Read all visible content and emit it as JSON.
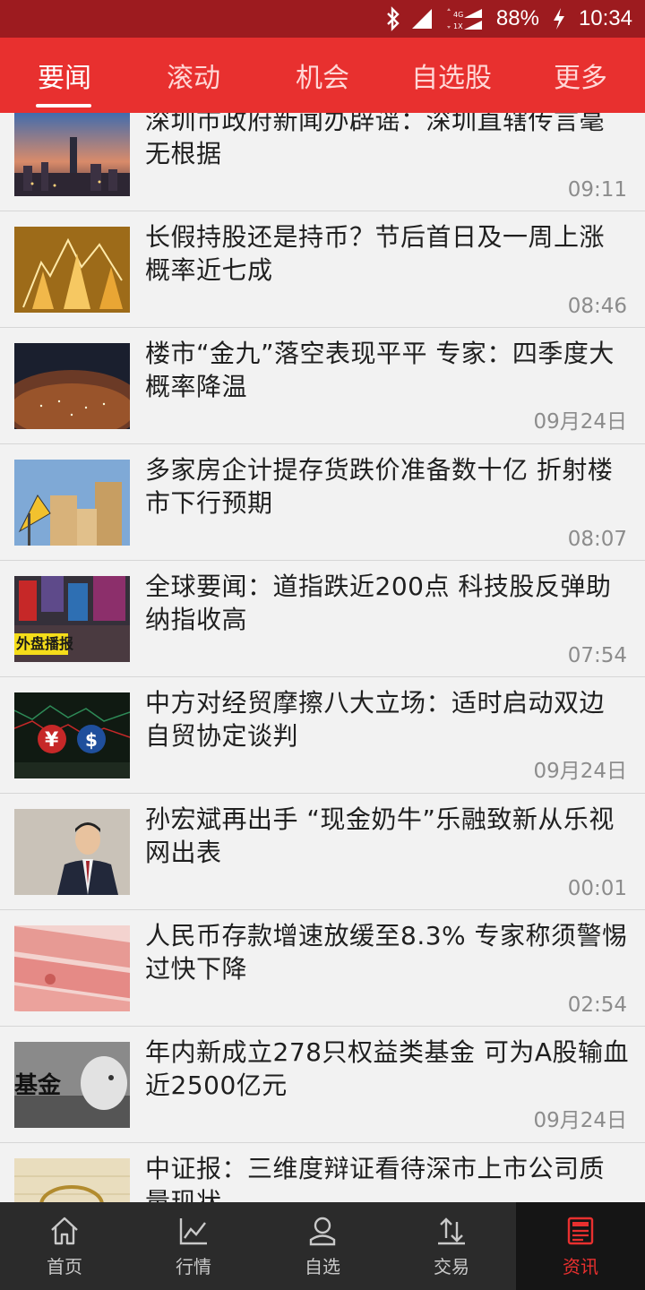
{
  "status_bar": {
    "battery": "88%",
    "time": "10:34",
    "network": "4G",
    "network2": "1X"
  },
  "tabs": [
    {
      "label": "要闻",
      "active": true
    },
    {
      "label": "滚动",
      "active": false
    },
    {
      "label": "机会",
      "active": false
    },
    {
      "label": "自选股",
      "active": false
    },
    {
      "label": "更多",
      "active": false
    }
  ],
  "news": [
    {
      "title": "深圳市政府新闻办辟谣：深圳直辖传言毫无根据",
      "time": "09:11",
      "thumb": "city-skyline"
    },
    {
      "title": "长假持股还是持币？节后首日及一周上涨概率近七成",
      "time": "08:46",
      "thumb": "rising-arrows"
    },
    {
      "title": "楼市“金九”落空表现平平 专家：四季度大概率降温",
      "time": "09月24日",
      "thumb": "city-night"
    },
    {
      "title": "多家房企计提存货跌价准备数十亿 折射楼市下行预期",
      "time": "08:07",
      "thumb": "buildings-down-sign"
    },
    {
      "title": "全球要闻：道指跌近200点 科技股反弹助纳指收高",
      "time": "07:54",
      "thumb": "times-square",
      "badge": "外盘播报"
    },
    {
      "title": "中方对经贸摩擦八大立场：适时启动双边自贸协定谈判",
      "time": "09月24日",
      "thumb": "yuan-dollar"
    },
    {
      "title": "孙宏斌再出手 “现金奶牛”乐融致新从乐视网出表",
      "time": "00:01",
      "thumb": "businessman"
    },
    {
      "title": "人民币存款增速放缓至8.3% 专家称须警惕过快下降",
      "time": "02:54",
      "thumb": "rmb-notes"
    },
    {
      "title": "年内新成立278只权益类基金 可为A股输血近2500亿元",
      "time": "09月24日",
      "thumb": "fund-piggy",
      "badge": "基金"
    },
    {
      "title": "中证报：三维度辩证看待深市上市公司质量现状",
      "time": "",
      "thumb": "coin-chart"
    }
  ],
  "bottom_nav": [
    {
      "label": "首页",
      "icon": "home-icon",
      "active": false
    },
    {
      "label": "行情",
      "icon": "chart-line-icon",
      "active": false
    },
    {
      "label": "自选",
      "icon": "user-icon",
      "active": false
    },
    {
      "label": "交易",
      "icon": "exchange-icon",
      "active": false
    },
    {
      "label": "资讯",
      "icon": "news-icon",
      "active": true
    }
  ],
  "colors": {
    "status_bar": "#9d1b1f",
    "tab_bar": "#e8302f",
    "nav_bar": "#2b2b2b",
    "accent": "#e8302f"
  }
}
